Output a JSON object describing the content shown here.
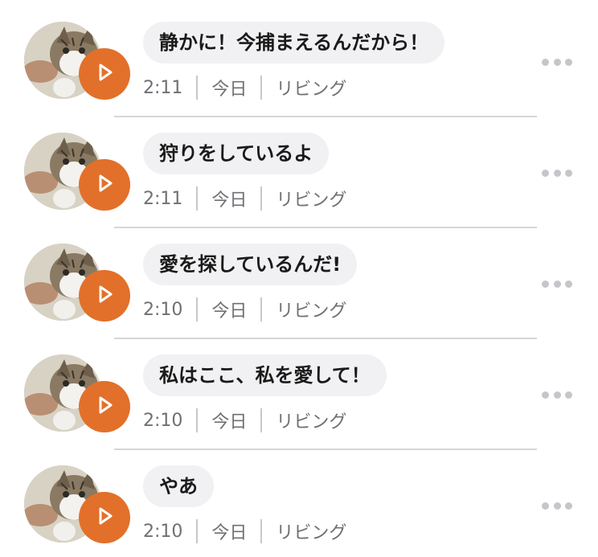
{
  "colors": {
    "accent": "#e2702a",
    "bubble_bg": "#f1f1f3",
    "meta_text": "#6f6f74",
    "divider": "#d6d6d9"
  },
  "icons": {
    "avatar": "cat-avatar",
    "play": "play-icon",
    "more": "more-horizontal-icon"
  },
  "messages": [
    {
      "text": "静かに！今捕まえるんだから！",
      "time": "2:11",
      "day": "今日",
      "room": "リビング"
    },
    {
      "text": "狩りをしているよ",
      "time": "2:11",
      "day": "今日",
      "room": "リビング"
    },
    {
      "text": "愛を探しているんだ!",
      "time": "2:10",
      "day": "今日",
      "room": "リビング"
    },
    {
      "text": "私はここ、私を愛して！",
      "time": "2:10",
      "day": "今日",
      "room": "リビング"
    },
    {
      "text": "やあ",
      "time": "2:10",
      "day": "今日",
      "room": "リビング"
    }
  ]
}
